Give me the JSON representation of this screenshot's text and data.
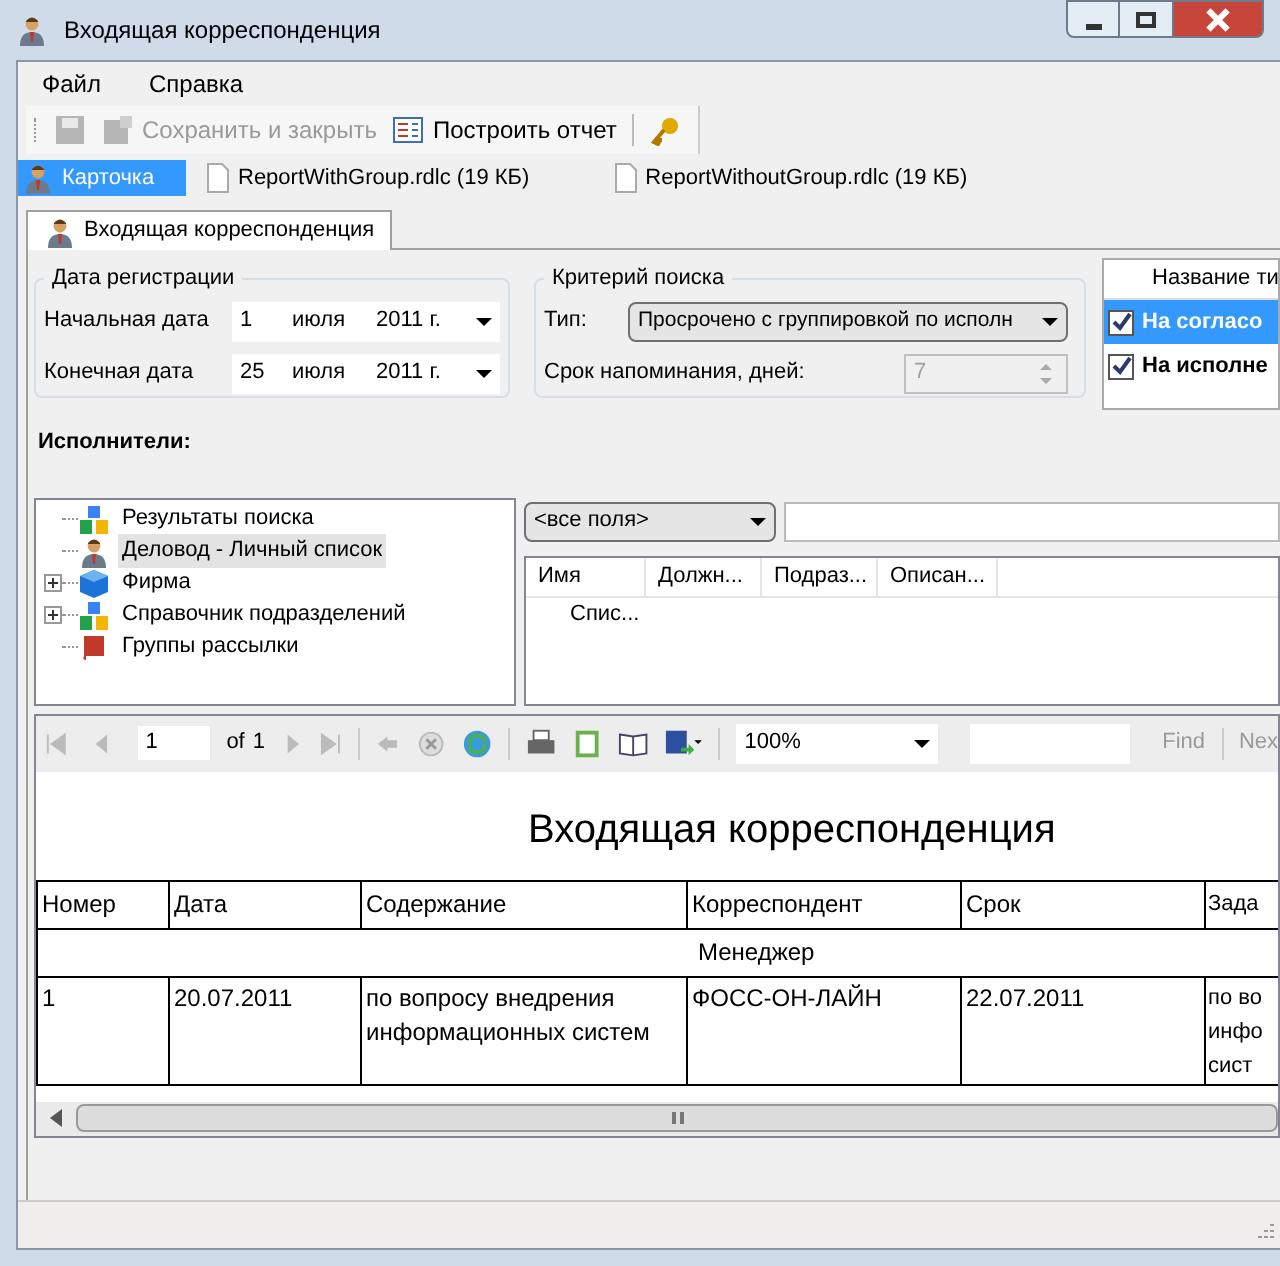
{
  "window": {
    "title": "Входящая корреспонденция"
  },
  "menu": [
    "Файл",
    "Справка"
  ],
  "toolbar": [
    {
      "kind": "save",
      "disabled": true
    },
    {
      "kind": "save-close",
      "label": "Сохранить и закрыть",
      "disabled": true
    },
    {
      "kind": "report",
      "label": "Построить отчет",
      "disabled": false
    },
    {
      "kind": "keys",
      "disabled": false
    }
  ],
  "file_tabs": [
    {
      "kind": "card",
      "label": "Карточка",
      "selected": true
    },
    {
      "kind": "file",
      "label": "ReportWithGroup.rdlc (19 КБ)",
      "selected": false
    },
    {
      "kind": "file",
      "label": "ReportWithoutGroup.rdlc (19 КБ)",
      "selected": false
    }
  ],
  "tabs": [
    {
      "label": "Входящая корреспонденция",
      "selected": true
    }
  ],
  "date_group": {
    "title": "Дата регистрации",
    "fields": [
      {
        "label": "Начальная дата",
        "day": "1",
        "month": "июля",
        "year": "2011 г."
      },
      {
        "label": "Конечная дата",
        "day": "25",
        "month": "июля",
        "year": "2011 г."
      }
    ]
  },
  "search_group": {
    "title": "Критерий поиска",
    "type_label": "Тип:",
    "type_value": "Просрочено с группировкой по исполн",
    "reminder_label": "Срок напоминания, дней:",
    "reminder_value": "7",
    "reminder_disabled": true
  },
  "status_list": {
    "header": "Название ти",
    "rows": [
      {
        "label": "На согласо",
        "checked": true,
        "selected": true
      },
      {
        "label": "На исполне",
        "checked": true,
        "selected": false
      }
    ]
  },
  "executors_label": "Исполнители:",
  "tree": [
    {
      "kind": "leaf",
      "label": "Результаты поиска",
      "selected": false
    },
    {
      "kind": "leaf",
      "label": "Деловод - Личный список",
      "selected": true
    },
    {
      "kind": "collapsed",
      "label": "Фирма",
      "selected": false
    },
    {
      "kind": "collapsed",
      "label": "Справочник подразделений",
      "selected": false
    },
    {
      "kind": "leaf",
      "label": "Группы рассылки",
      "selected": false
    }
  ],
  "filter": {
    "field": "<все поля>"
  },
  "list": {
    "columns": [
      "Имя",
      "Должн...",
      "Подраз...",
      "Описан..."
    ],
    "rows": [
      [
        "Спис..."
      ]
    ]
  },
  "report": {
    "page": "1",
    "of": "of",
    "total": "1",
    "zoom": "100%",
    "find": "Find",
    "next": "Nex",
    "title": "Входящая корреспонденция",
    "columns": [
      "Номер",
      "Дата",
      "Содержание",
      "Корреспондент",
      "Срок",
      "Зада"
    ],
    "group": "Менеджер",
    "rows": [
      [
        "1",
        "20.07.2011",
        "по вопросу внедрения информационных систем",
        "ФОСС-ОН-ЛАЙН",
        "22.07.2011",
        "по во инфо сист"
      ]
    ]
  }
}
